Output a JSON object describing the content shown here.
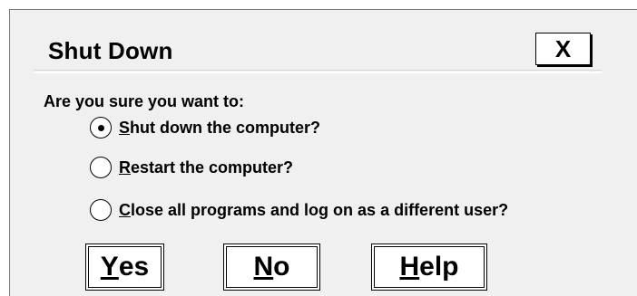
{
  "dialog": {
    "title": "Shut Down",
    "close_label": "X",
    "prompt": "Are you sure you want to:",
    "options": [
      {
        "mnemonic": "S",
        "rest": "hut down the computer?",
        "selected": true
      },
      {
        "mnemonic": "R",
        "rest": "estart the computer?",
        "selected": false
      },
      {
        "mnemonic": "C",
        "rest": "lose all programs and log on as a different user?",
        "selected": false
      }
    ],
    "buttons": {
      "yes": {
        "mnemonic": "Y",
        "rest": "es"
      },
      "no": {
        "mnemonic": "N",
        "rest": "o"
      },
      "help": {
        "mnemonic": "H",
        "rest": "elp"
      }
    }
  },
  "colors": {
    "dialog_background": "#f0f0f0",
    "button_background": "#ffffff",
    "text": "#000000"
  }
}
